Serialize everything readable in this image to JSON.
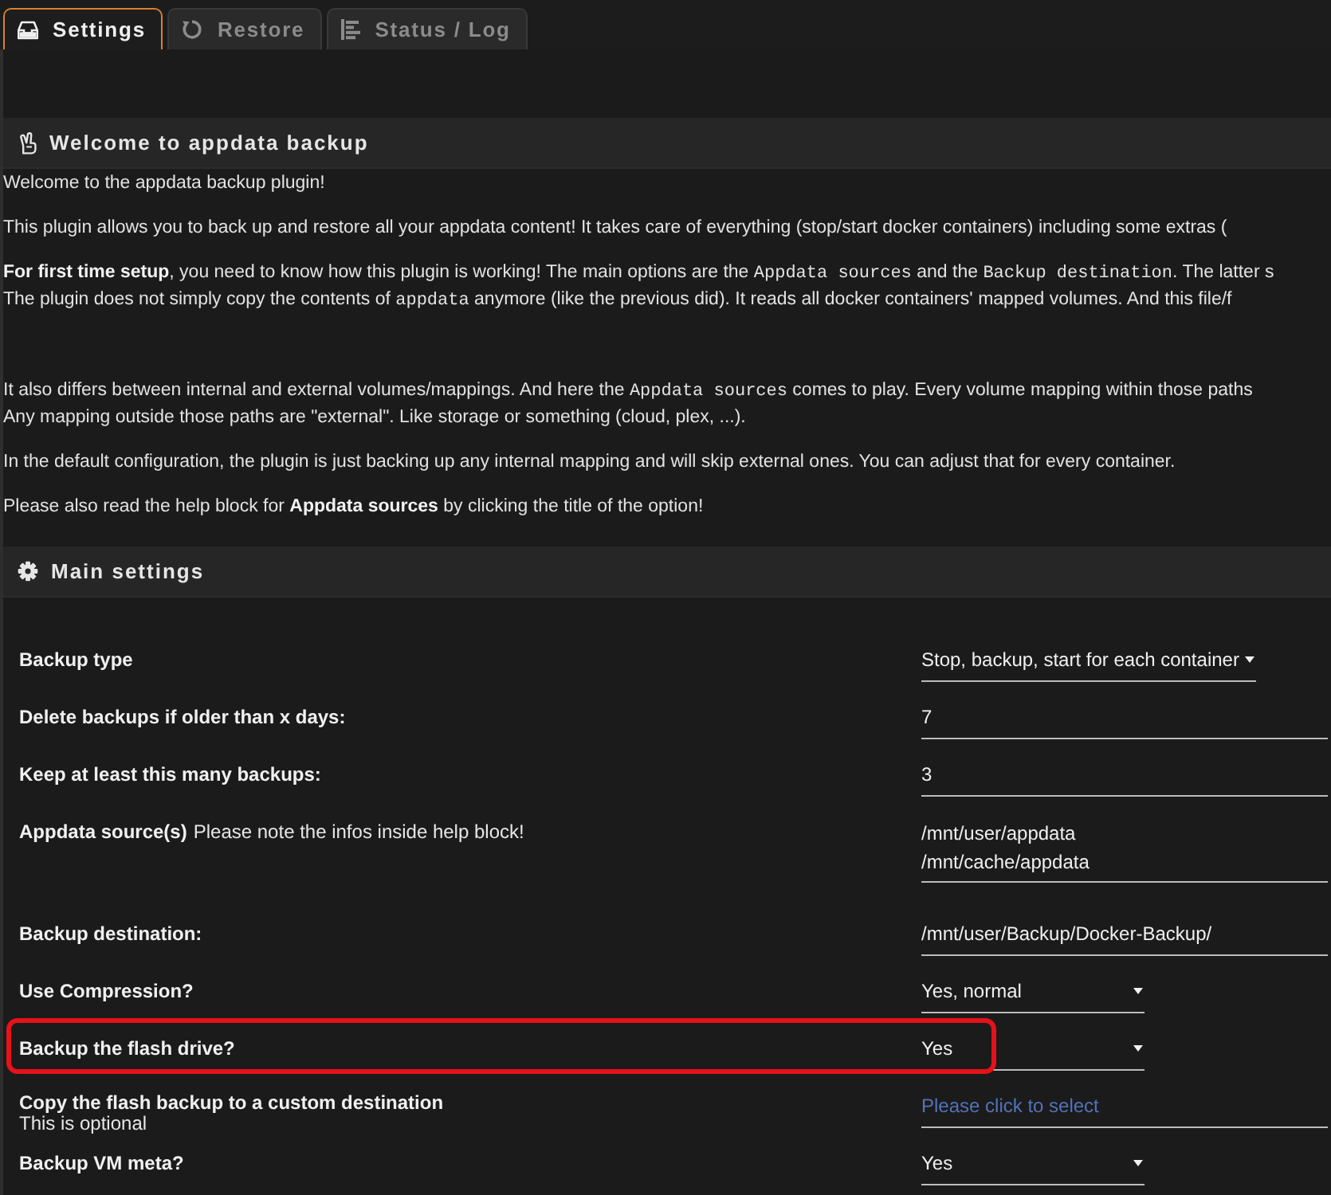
{
  "tabs": [
    {
      "label": "Settings",
      "selected": true
    },
    {
      "label": "Restore",
      "selected": false
    },
    {
      "label": "Status / Log",
      "selected": false
    }
  ],
  "sections": [
    {
      "title": "Welcome to appdata backup",
      "paragraphs": [
        {
          "lines": [
            [
              {
                "kind": "plain",
                "text": "Welcome to the appdata backup plugin!"
              }
            ]
          ]
        },
        {
          "lines": [
            [
              {
                "kind": "plain",
                "text": "This plugin allows you to back up and restore all your appdata content! It takes care of everything (stop/start docker containers) including some extras ("
              }
            ]
          ]
        },
        {
          "lines": [
            [
              {
                "kind": "bold",
                "text": "For first time setup"
              },
              {
                "kind": "plain",
                "text": ", you need to know how this plugin is working! The main options are the "
              },
              {
                "kind": "code",
                "text": "Appdata sources"
              },
              {
                "kind": "plain",
                "text": " and the "
              },
              {
                "kind": "code",
                "text": "Backup destination"
              },
              {
                "kind": "plain",
                "text": ". The latter s"
              }
            ],
            [
              {
                "kind": "plain",
                "text": "The plugin does not simply copy the contents of "
              },
              {
                "kind": "code",
                "text": "appdata"
              },
              {
                "kind": "plain",
                "text": " anymore (like the previous did). It reads all docker containers' mapped volumes. And this file/f"
              }
            ]
          ]
        },
        {
          "lines": [
            [
              {
                "kind": "plain",
                "text": "It also differs between internal and external volumes/mappings. And here the "
              },
              {
                "kind": "code",
                "text": "Appdata sources"
              },
              {
                "kind": "plain",
                "text": " comes to play. Every volume mapping within those paths"
              }
            ],
            [
              {
                "kind": "plain",
                "text": "Any mapping outside those paths are \"external\". Like storage or something (cloud, plex, ...)."
              }
            ]
          ]
        },
        {
          "lines": [
            [
              {
                "kind": "plain",
                "text": "In the default configuration, the plugin is just backing up any internal mapping and will skip external ones. You can adjust that for every container."
              }
            ]
          ]
        },
        {
          "lines": [
            [
              {
                "kind": "plain",
                "text": "Please also read the help block for "
              },
              {
                "kind": "bold",
                "text": "Appdata sources"
              },
              {
                "kind": "plain",
                "text": " by clicking the title of the option!"
              }
            ]
          ]
        }
      ]
    },
    {
      "title": "Main settings",
      "settings": [
        {
          "kind": "select",
          "label": "Backup type",
          "value": "Stop, backup, start for each container",
          "highlighted": false
        },
        {
          "kind": "input",
          "label": "Delete backups if older than x days:",
          "value": "7",
          "highlighted": false
        },
        {
          "kind": "input",
          "label": "Keep at least this many backups:",
          "value": "3",
          "highlighted": false
        },
        {
          "kind": "textarea",
          "label": "Appdata source(s)",
          "note": "Please note the infos inside help block!",
          "lines": [
            "/mnt/user/appdata",
            "/mnt/cache/appdata"
          ],
          "highlighted": false
        },
        {
          "kind": "input",
          "label": "Backup destination:",
          "value": "/mnt/user/Backup/Docker-Backup/",
          "highlighted": false
        },
        {
          "kind": "select",
          "label": "Use Compression?",
          "value": "Yes, normal",
          "highlighted": false
        },
        {
          "kind": "select",
          "label": "Backup the flash drive?",
          "value": "Yes",
          "highlighted": true
        },
        {
          "kind": "picker",
          "label": "Copy the flash backup to a custom destination",
          "hint": "This is optional",
          "placeholder": "Please click to select",
          "highlighted": false
        },
        {
          "kind": "select",
          "label": "Backup VM meta?",
          "value": "Yes",
          "highlighted": false
        }
      ]
    }
  ]
}
